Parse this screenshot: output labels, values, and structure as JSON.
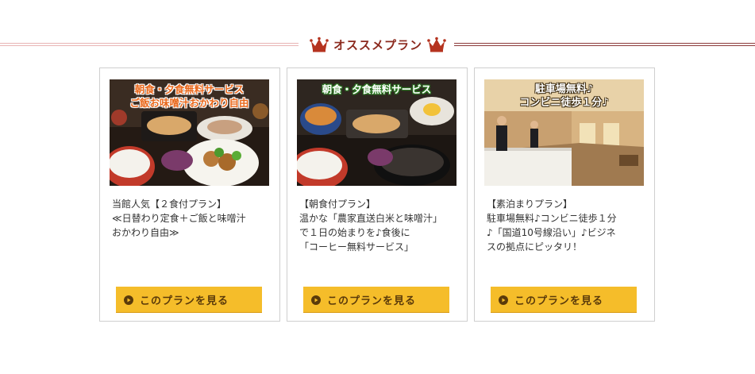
{
  "section": {
    "title": "オススメプラン"
  },
  "plans": [
    {
      "caption": [
        "朝食・夕食無料サービス",
        "ご飯お味噌汁おかわり自由"
      ],
      "description": [
        "当館人気【２食付プラン】",
        "≪日替わり定食＋ご飯と味噌汁",
        "おかわり自由≫"
      ],
      "button_label": "このプランを見る"
    },
    {
      "caption": [
        "朝食・夕食無料サービス"
      ],
      "description": [
        "【朝食付プラン】",
        "温かな「農家直送白米と味噌汁」",
        "で１日の始まりを♪食後に",
        "「コーヒー無料サービス」"
      ],
      "button_label": "このプランを見る"
    },
    {
      "caption": [
        "駐車場無料♪",
        "コンビニ徒歩１分♪"
      ],
      "description": [
        "【素泊まりプラン】",
        "駐車場無料♪コンビニ徒歩１分",
        "♪「国道10号線沿い」♪ビジネ",
        "スの拠点にピッタリ！"
      ],
      "button_label": "このプランを見る"
    }
  ],
  "colors": {
    "accent": "#8c2a1e",
    "button": "#f5bd2a",
    "caption_orange": "#e9671a"
  },
  "icons": {
    "crown": "crown-icon",
    "button": "play-circle-icon"
  }
}
